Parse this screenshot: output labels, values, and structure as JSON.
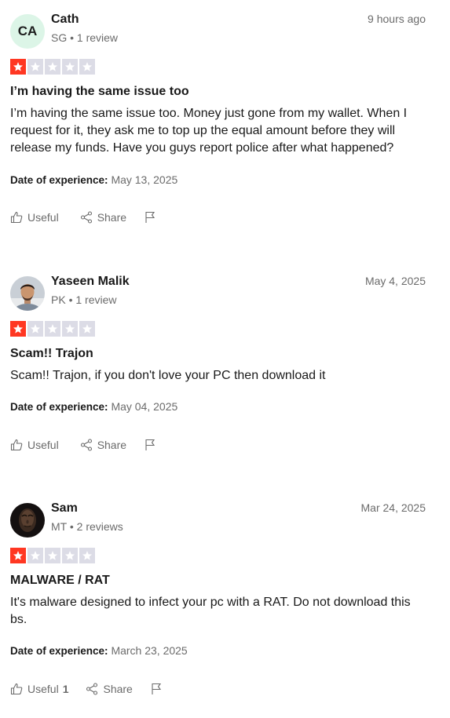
{
  "reviews": [
    {
      "avatar_initials": "CA",
      "name": "Cath",
      "meta": "SG • 1 review",
      "date": "9 hours ago",
      "rating": 1,
      "title": "I’m having the same issue too",
      "body": "I’m having the same issue too. Money just gone from my wallet. When I request for it, they ask me to top up the equal amount before they will release my funds. Have you guys report police after what happened?",
      "experience_label": "Date of experience:",
      "experience_date": "May 13, 2025",
      "useful_label": "Useful",
      "useful_count": "",
      "share_label": "Share"
    },
    {
      "avatar_initials": "",
      "name": "Yaseen Malik",
      "meta": "PK • 1 review",
      "date": "May 4, 2025",
      "rating": 1,
      "title": "Scam!! Trajon",
      "body": "Scam!! Trajon, if you don't love your PC then download it",
      "experience_label": "Date of experience:",
      "experience_date": "May 04, 2025",
      "useful_label": "Useful",
      "useful_count": "",
      "share_label": "Share"
    },
    {
      "avatar_initials": "",
      "name": "Sam",
      "meta": "MT • 2 reviews",
      "date": "Mar 24, 2025",
      "rating": 1,
      "title": "MALWARE / RAT",
      "body": "It's malware designed to infect your pc with a RAT. Do not download this bs.",
      "experience_label": "Date of experience:",
      "experience_date": "March 23, 2025",
      "useful_label": "Useful",
      "useful_count": "1",
      "share_label": "Share"
    }
  ],
  "colors": {
    "star_on": "#ff3722",
    "star_off": "#dcdce6",
    "initials_bg": "#dcf5e7",
    "muted_text": "#6b6b6b"
  },
  "icons": {
    "star": "star-icon",
    "useful": "thumbs-up-icon",
    "share": "share-icon",
    "flag": "flag-icon"
  }
}
